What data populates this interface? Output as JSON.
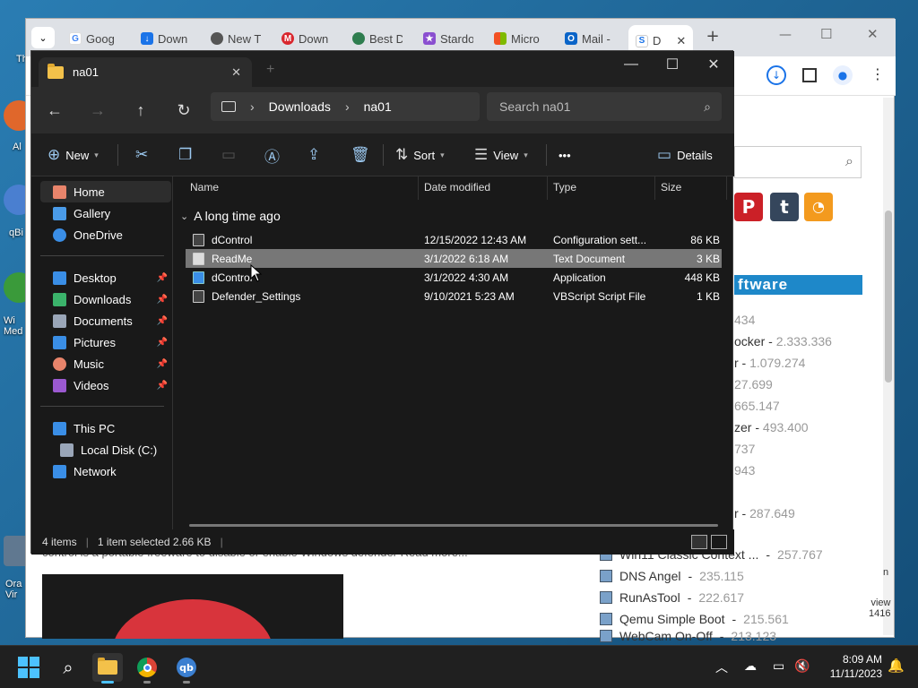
{
  "desktop": {
    "labels": [
      "Th",
      "Al",
      "qBi",
      "Wi Med",
      "Ora Vir"
    ]
  },
  "chrome": {
    "tabs": [
      {
        "icon": "google-icon",
        "label": "Goog"
      },
      {
        "icon": "download-icon",
        "label": "Down"
      },
      {
        "icon": "chrome-icon",
        "label": "New T"
      },
      {
        "icon": "mega-icon",
        "label": "Down"
      },
      {
        "icon": "best-icon",
        "label": "Best D"
      },
      {
        "icon": "stardock-icon",
        "label": "Stardo"
      },
      {
        "icon": "microsoft-icon",
        "label": "Micro"
      },
      {
        "icon": "outlook-icon",
        "label": "Mail -"
      },
      {
        "icon": "sordum-icon",
        "label": "D"
      }
    ],
    "new_tab": "+",
    "web": {
      "banner": "ftware",
      "list": [
        {
          "name": "",
          "count": "434"
        },
        {
          "name": "ocker",
          "count": "2.333.336"
        },
        {
          "name": "r",
          "count": "1.079.274"
        },
        {
          "name": "",
          "count": "27.699"
        },
        {
          "name": "",
          "count": "665.147"
        },
        {
          "name": "zer",
          "count": "493.400"
        },
        {
          "name": "",
          "count": "737"
        },
        {
          "name": "",
          "count": "943"
        },
        {
          "name": "r",
          "count": "287.649"
        }
      ],
      "sidebar_items": [
        {
          "name": "Win11 Classic Context ...",
          "count": "257.767"
        },
        {
          "name": "DNS Angel",
          "count": "235.115"
        },
        {
          "name": "RunAsTool",
          "count": "222.617"
        },
        {
          "name": "Qemu Simple Boot",
          "count": "215.561"
        },
        {
          "name": "WebCam On-Off",
          "count": "213.123"
        }
      ],
      "article_text": "control is a portable freeware to disable or enable Windows defender Read more...",
      "right_edge": [
        "n",
        "view",
        "1416"
      ]
    }
  },
  "explorer": {
    "tab_title": "na01",
    "breadcrumb": [
      "Downloads",
      "na01"
    ],
    "search_placeholder": "Search na01",
    "toolbar": {
      "new": "New",
      "sort": "Sort",
      "view": "View",
      "more": "•••",
      "details": "Details"
    },
    "nav": {
      "top": [
        {
          "label": "Home",
          "icon": "home-icon",
          "color": "#e8846b"
        },
        {
          "label": "Gallery",
          "icon": "gallery-icon",
          "color": "#4a9be8"
        },
        {
          "label": "OneDrive",
          "icon": "onedrive-icon",
          "color": "#3a8ee6"
        }
      ],
      "pinned": [
        {
          "label": "Desktop",
          "icon": "desktop-icon",
          "color": "#3a8ee6"
        },
        {
          "label": "Downloads",
          "icon": "downloads-icon",
          "color": "#3bb36b"
        },
        {
          "label": "Documents",
          "icon": "documents-icon",
          "color": "#9aa6b8"
        },
        {
          "label": "Pictures",
          "icon": "pictures-icon",
          "color": "#3a8ee6"
        },
        {
          "label": "Music",
          "icon": "music-icon",
          "color": "#e8846b"
        },
        {
          "label": "Videos",
          "icon": "videos-icon",
          "color": "#9b59d0"
        }
      ],
      "pc": [
        {
          "label": "This PC",
          "icon": "pc-icon",
          "color": "#3a8ee6"
        },
        {
          "label": "Local Disk (C:)",
          "icon": "disk-icon",
          "color": "#9aa6b8"
        },
        {
          "label": "Network",
          "icon": "network-icon",
          "color": "#3a8ee6"
        }
      ]
    },
    "columns": [
      "Name",
      "Date modified",
      "Type",
      "Size"
    ],
    "group": "A long time ago",
    "files": [
      {
        "name": "dControl",
        "date": "12/15/2022 12:43 AM",
        "type": "Configuration sett...",
        "size": "86 KB"
      },
      {
        "name": "ReadMe",
        "date": "3/1/2022 6:18 AM",
        "type": "Text Document",
        "size": "3 KB"
      },
      {
        "name": "dControl",
        "date": "3/1/2022 4:30 AM",
        "type": "Application",
        "size": "448 KB"
      },
      {
        "name": "Defender_Settings",
        "date": "9/10/2021 5:23 AM",
        "type": "VBScript Script File",
        "size": "1 KB"
      }
    ],
    "status": {
      "count": "4 items",
      "selection": "1 item selected  2.66 KB"
    }
  },
  "taskbar": {
    "time": "8:09 AM",
    "date": "11/11/2023"
  }
}
